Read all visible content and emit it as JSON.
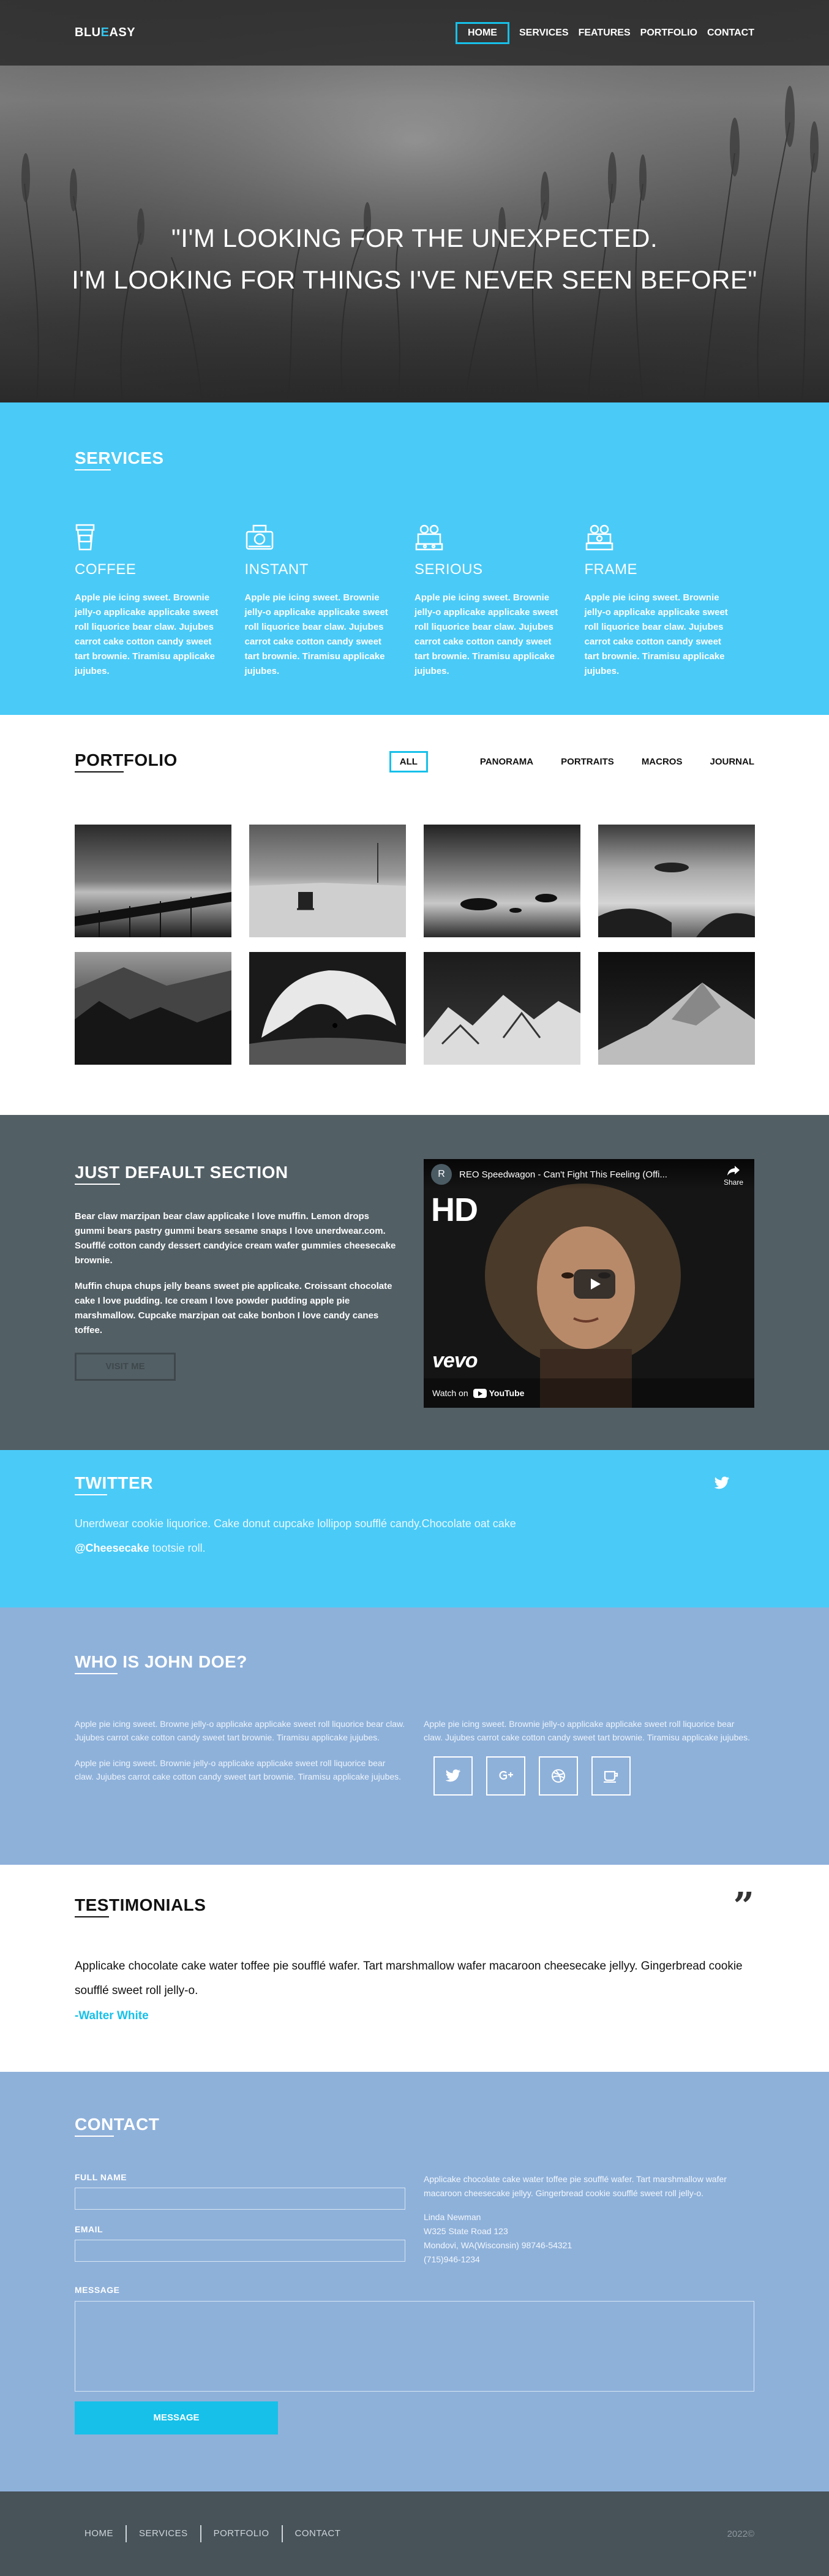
{
  "header": {
    "logo_part1": "BLU",
    "logo_part2": "E",
    "logo_part3": "ASY",
    "nav": [
      "HOME",
      "SERVICES",
      "FEATURES",
      "PORTFOLIO",
      "CONTACT"
    ]
  },
  "hero": {
    "line1": "\"I'M LOOKING FOR THE UNEXPECTED.",
    "line2": "I'M LOOKING FOR THINGS I'VE NEVER SEEN BEFORE\""
  },
  "services": {
    "title_ul": "SER",
    "title_rest": "VICES",
    "items": [
      {
        "title": "COFFEE",
        "icon": "coffee-cup-icon",
        "text": "Apple pie icing sweet. Brownie jelly-o applicake applicake sweet roll liquorice bear claw. Jujubes carrot cake cotton candy sweet tart brownie. Tiramisu applicake jujubes."
      },
      {
        "title": "INSTANT",
        "icon": "instant-camera-icon",
        "text": "Apple pie icing sweet. Brownie jelly-o applicake applicake sweet roll liquorice bear claw. Jujubes carrot cake cotton candy sweet tart brownie. Tiramisu applicake jujubes."
      },
      {
        "title": "SERIOUS",
        "icon": "reel-camera-icon",
        "text": "Apple pie icing sweet. Brownie jelly-o applicake applicake sweet roll liquorice bear claw. Jujubes carrot cake cotton candy sweet tart brownie. Tiramisu applicake jujubes."
      },
      {
        "title": "FRAME",
        "icon": "film-camera-icon",
        "text": "Apple pie icing sweet. Brownie jelly-o applicake applicake sweet roll liquorice bear claw. Jujubes carrot cake cotton candy sweet tart brownie. Tiramisu applicake jujubes."
      }
    ]
  },
  "portfolio": {
    "title_ul": "PORT",
    "title_rest": "FOLIO",
    "filters": [
      "ALL",
      "PANORAMA",
      "PORTRAITS",
      "MACROS",
      "JOURNAL"
    ]
  },
  "default_section": {
    "title_ul": "JUST",
    "title_rest": " DEFAULT SECTION",
    "p1": "Bear claw marzipan bear claw applicake I love muffin. Lemon drops gummi bears pastry gummi bears sesame snaps I love unerdwear.com. Soufflé cotton candy dessert candyice cream wafer gummies cheesecake brownie.",
    "p2": "Muffin chupa chups jelly beans sweet pie applicake. Croissant chocolate cake I love pudding. Ice cream I love powder pudding apple pie marshmallow. Cupcake marzipan oat cake bonbon I love candy canes toffee.",
    "button": "VISIT ME",
    "video": {
      "channel_initial": "R",
      "title": "REO Speedwagon - Can't Fight This Feeling (Offi...",
      "share": "Share",
      "hd": "HD",
      "vevo": "vevo",
      "watch_on": "Watch on",
      "youtube": "YouTube"
    }
  },
  "twitter": {
    "title_ul": "TWI",
    "title_rest": "TTER",
    "text": "Unerdwear cookie liquorice. Cake donut cupcake lollipop soufflé candy.Chocolate oat cake",
    "handle": "@Cheesecake",
    "text2": " tootsie roll."
  },
  "who": {
    "title_ul": "WHO",
    "title_rest": " IS JOHN DOE?",
    "left_p1": "Apple pie icing sweet. Browne jelly-o applicake applicake sweet roll liquorice bear claw. Jujubes carrot cake cotton candy sweet tart brownie. Tiramisu applicake jujubes.",
    "left_p2": "Apple pie icing sweet. Brownie jelly-o applicake applicake sweet roll liquorice bear claw. Jujubes carrot cake cotton candy sweet tart brownie. Tiramisu applicake jujubes.",
    "right_p1": "Apple pie icing sweet. Brownie jelly-o applicake applicake sweet roll liquorice bear claw. Jujubes carrot cake cotton candy sweet tart brownie. Tiramisu applicake jujubes.",
    "socials": [
      "twitter-icon",
      "google-plus-icon",
      "dribbble-icon",
      "coffee-icon"
    ]
  },
  "testimonials": {
    "title_ul": "TES",
    "title_rest": "TIMONIALS",
    "quote_mark": "”",
    "text": "Applicake chocolate cake water toffee pie soufflé wafer. Tart marshmallow wafer macaroon cheesecake jellyy. Gingerbread cookie soufflé sweet roll jelly-o.",
    "author": "-Walter White"
  },
  "contact": {
    "title_ul": "CON",
    "title_rest": "TACT",
    "full_name_label": "FULL NAME",
    "email_label": "EMAIL",
    "message_label": "MESSAGE",
    "send_button": "MESSAGE",
    "about": "Applicake chocolate cake water toffee pie soufflé wafer. Tart marshmallow wafer macaroon cheesecake jellyy. Gingerbread cookie soufflé sweet roll jelly-o.",
    "name": "Linda Newman",
    "address1": "W325 State Road 123",
    "address2": "Mondovi, WA(Wisconsin) 98746-54321",
    "phone": "(715)946-1234"
  },
  "footer": {
    "nav": [
      "HOME",
      "SERVICES",
      "PORTFOLIO",
      "CONTACT"
    ],
    "copy": "2022©"
  },
  "colors": {
    "accent": "#17c0e9",
    "services_bg": "#4acaf7",
    "default_bg": "#525f65",
    "who_bg": "#8eb1da",
    "footer_bg": "#475259"
  }
}
